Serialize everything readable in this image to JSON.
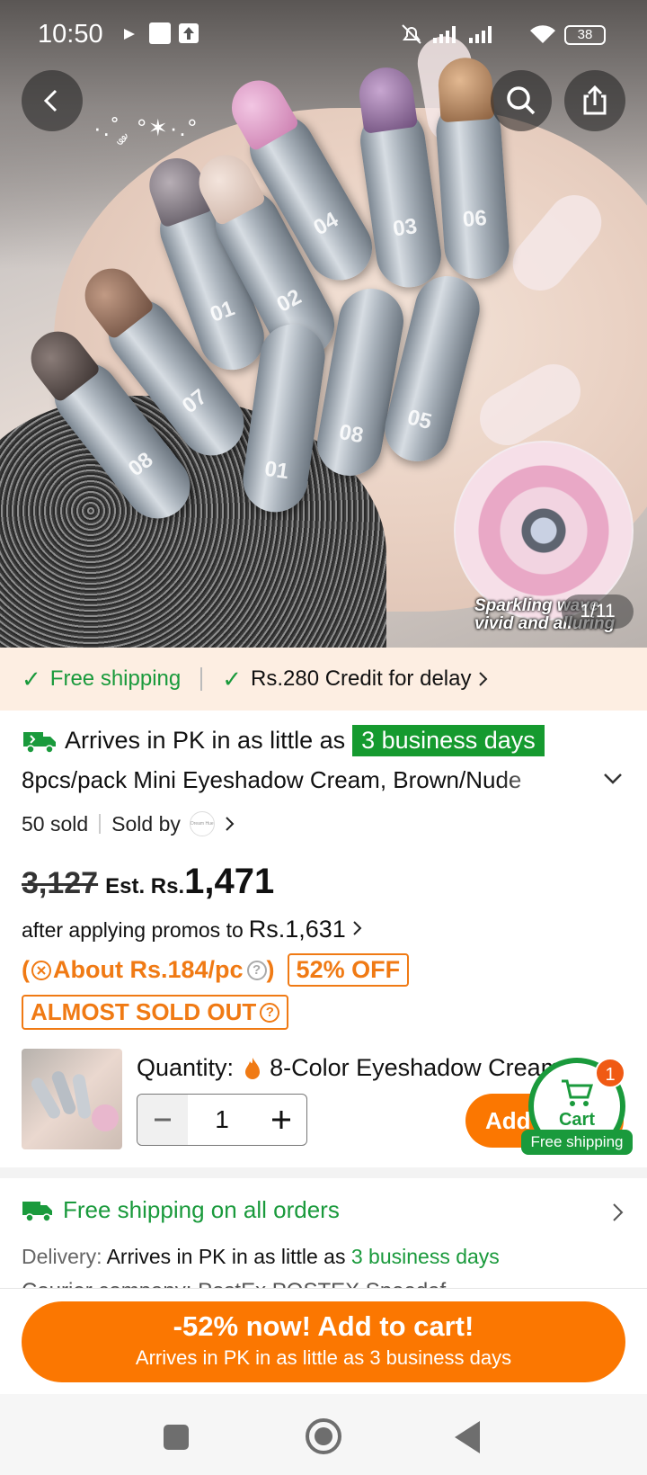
{
  "status_bar": {
    "time": "10:50",
    "battery": "38"
  },
  "hero": {
    "caption_line1": "Sparkling wave",
    "caption_line2": "vivid and alluring",
    "counter": "1/11",
    "sparkle_text": "·.˚ ༘ °✶·.°",
    "tube_numbers": [
      "08",
      "07",
      "01",
      "02",
      "04",
      "03",
      "06",
      "01",
      "08",
      "05"
    ]
  },
  "benefits": {
    "free_shipping": "Free shipping",
    "credit": "Rs.280 Credit for delay"
  },
  "product": {
    "arrive_prefix": "Arrives in PK in as little as",
    "arrive_highlight": "3 business days",
    "title": "8pcs/pack Mini Eyeshadow Cream, Brown/Nude",
    "sold": "50 sold",
    "sold_by": "Sold by",
    "seller_logo_text": "Dream  Hue",
    "original_price": "3,127",
    "est_label": "Est. Rs.",
    "price": "1,471",
    "promo_text": "after applying promos to",
    "promo_price": "Rs.1,631",
    "per_piece": "About Rs.184/pc",
    "discount_badge": "52% OFF",
    "almost_sold_out": "ALMOST SOLD OUT"
  },
  "quantity": {
    "label": "Quantity:",
    "variant": "8-Color Eyeshadow Cream",
    "value": "1",
    "add_button": "Add to cart"
  },
  "cart_fab": {
    "label": "Cart",
    "badge": "1",
    "free_shipping": "Free shipping"
  },
  "shipping": {
    "title": "Free shipping on all orders",
    "delivery_label": "Delivery:",
    "delivery_text": "Arrives in PK in as little as",
    "delivery_highlight": "3 business days",
    "carrier_peek": "Courier company: PostEx POSTEX Speedaf"
  },
  "cta": {
    "line1": "-52% now! Add to cart!",
    "line2": "Arrives in PK in as little as 3 business days"
  },
  "colors": {
    "brand_orange": "#fb7701",
    "green": "#1a9a3c",
    "promo_orange": "#f07a14",
    "benefits_bg": "#fdeee2"
  }
}
